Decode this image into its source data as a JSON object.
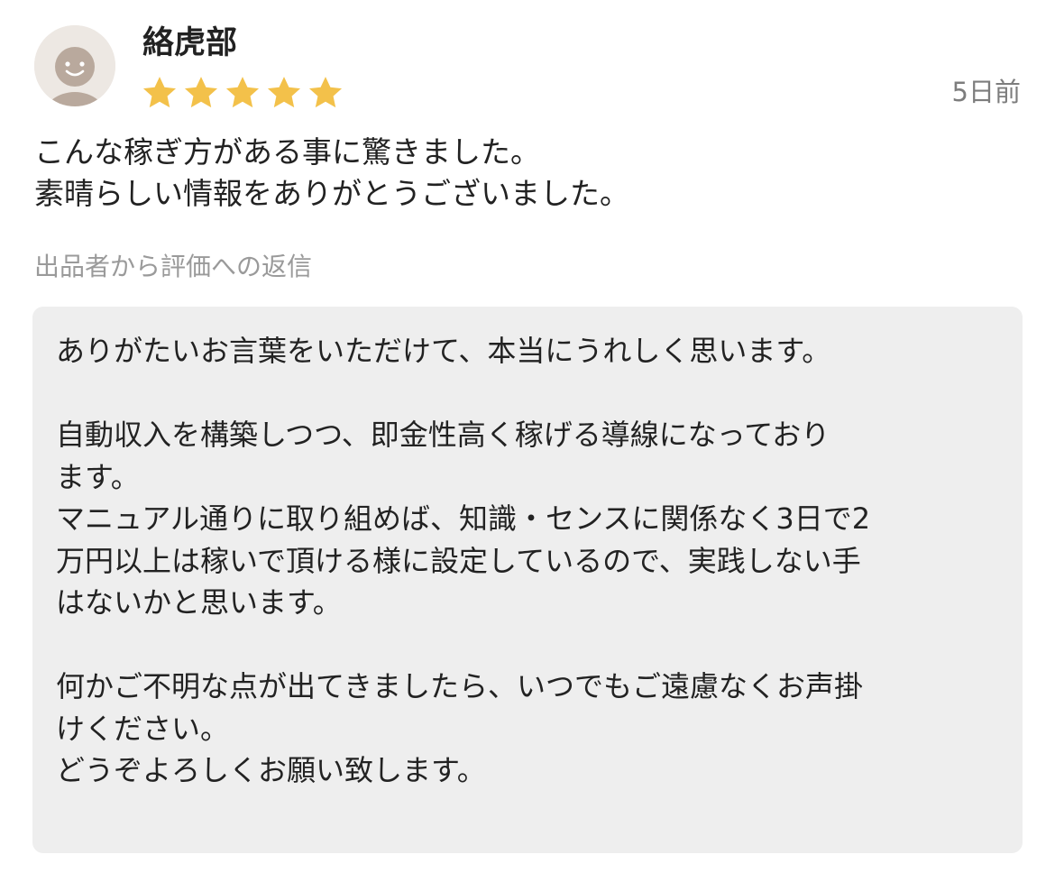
{
  "review": {
    "reviewer_name": "絡虎部",
    "rating": 5,
    "rating_max": 5,
    "star_color": "#f3c14a",
    "time_ago": "5日前",
    "text_lines": [
      "こんな稼ぎ方がある事に驚きました。",
      "素晴らしい情報をありがとうございました。"
    ]
  },
  "reply": {
    "label": "出品者から評価への返信",
    "text_lines": [
      "ありがたいお言葉をいただけて、本当にうれしく思います。",
      "",
      "自動収入を構築しつつ、即金性高く稼げる導線になっており",
      "ます。",
      "マニュアル通りに取り組めば、知識・センスに関係なく3日で2",
      "万円以上は稼いで頂ける様に設定しているので、実践しない手",
      "はないかと思います。",
      "",
      "何かご不明な点が出てきましたら、いつでもご遠慮なくお声掛",
      "けください。",
      "どうぞよろしくお願い致します。"
    ]
  },
  "icons": {
    "avatar": "default-user-avatar-icon",
    "star": "star-icon"
  }
}
